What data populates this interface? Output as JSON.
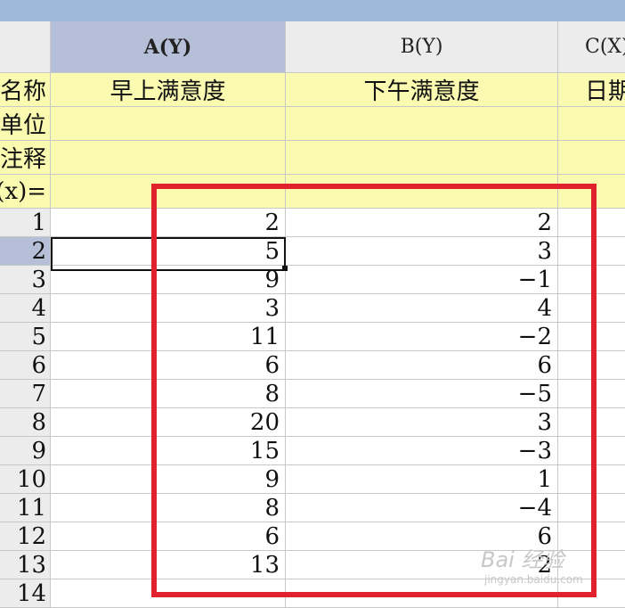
{
  "columns": [
    {
      "header": "A(Y)",
      "name": "早上满意度",
      "active": true
    },
    {
      "header": "B(Y)",
      "name": "下午满意度",
      "active": false
    },
    {
      "header": "C(X)",
      "name": "日期",
      "active": false
    }
  ],
  "meta_labels": [
    "名称",
    "单位",
    "注释",
    "F(x)="
  ],
  "rows": [
    {
      "label": "1",
      "a": "2",
      "b": "2"
    },
    {
      "label": "2",
      "a": "5",
      "b": "3"
    },
    {
      "label": "3",
      "a": "9",
      "b": "−1"
    },
    {
      "label": "4",
      "a": "3",
      "b": "4"
    },
    {
      "label": "5",
      "a": "11",
      "b": "−2"
    },
    {
      "label": "6",
      "a": "6",
      "b": "6"
    },
    {
      "label": "7",
      "a": "8",
      "b": "−5"
    },
    {
      "label": "8",
      "a": "20",
      "b": "3"
    },
    {
      "label": "9",
      "a": "15",
      "b": "−3"
    },
    {
      "label": "10",
      "a": "9",
      "b": "1"
    },
    {
      "label": "11",
      "a": "8",
      "b": "−4"
    },
    {
      "label": "12",
      "a": "6",
      "b": "6"
    },
    {
      "label": "13",
      "a": "13",
      "b": "2"
    },
    {
      "label": "14",
      "a": "",
      "b": ""
    }
  ],
  "selected_row": "2",
  "watermark": {
    "main": "Bai 经验",
    "sub": "jingyan.baidu.com"
  },
  "colors": {
    "highlight_box": "#e0222c",
    "meta_background": "#fafab0",
    "active_header": "#b6bfd8"
  }
}
